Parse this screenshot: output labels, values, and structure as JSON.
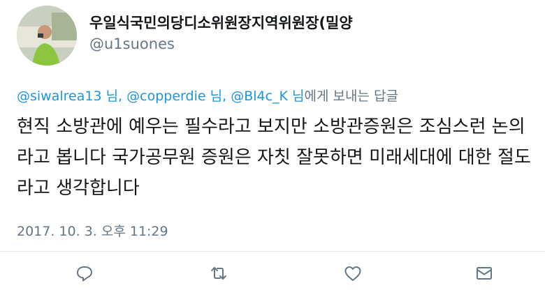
{
  "user": {
    "display_name": "우일식국민의당디소위원장지역위원장(밀양",
    "handle": "@u1suones"
  },
  "reply_to": {
    "mentions": [
      "@siwalrea13",
      "@copperdie",
      "@Bl4c_K"
    ],
    "honorific": "님",
    "separator": ",",
    "suffix": "에게 보내는 답글"
  },
  "tweet": {
    "text": "현직 소방관에 예우는 필수라고 보지만 소방관증원은 조심스런 논의라고 봅니다 국가공무원 증원은 자칫 잘못하면 미래세대에 대한 절도라고 생각합니다",
    "timestamp": "2017. 10. 3. 오후 11:29"
  },
  "actions": {
    "reply_icon": "speech-bubble",
    "retweet_icon": "retweet-arrows",
    "like_icon": "heart",
    "dm_icon": "envelope"
  },
  "colors": {
    "link": "#1b95e0",
    "secondary_text": "#657786",
    "primary_text": "#14171a",
    "divider": "#e1e8ed"
  }
}
